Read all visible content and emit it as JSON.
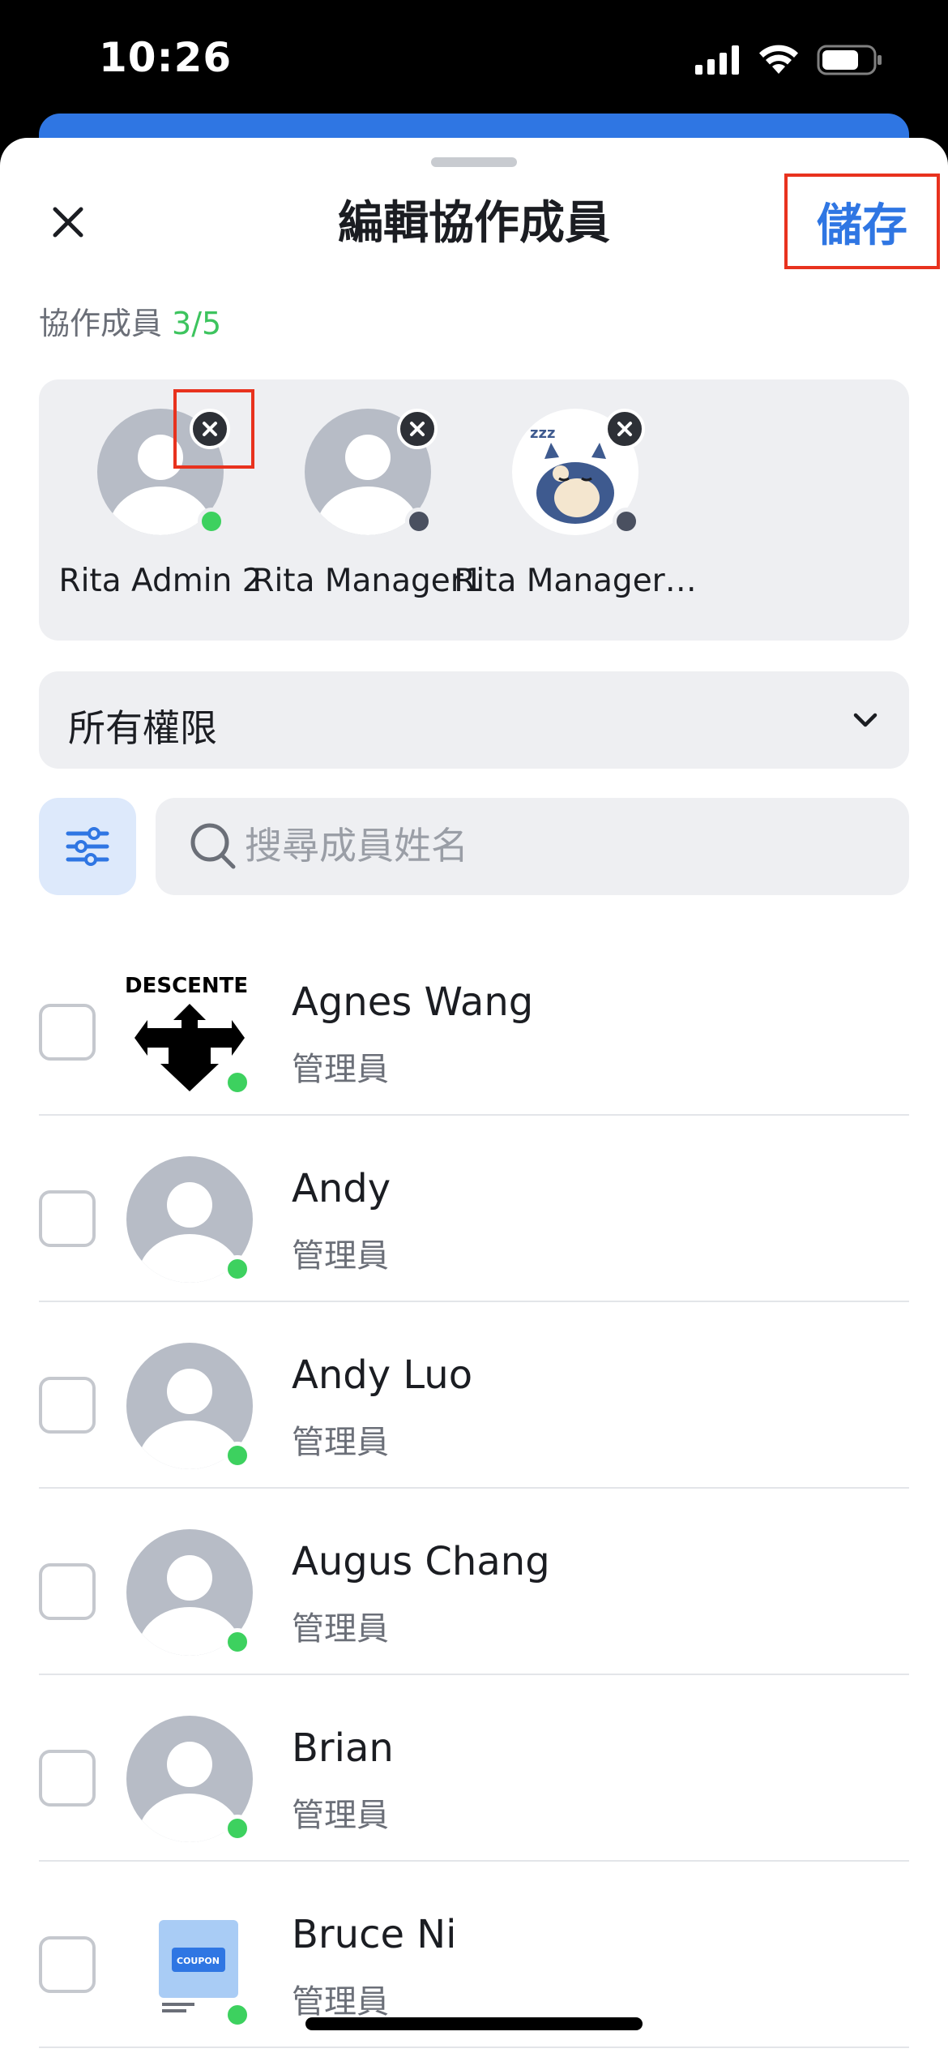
{
  "status_bar": {
    "time": "10:26"
  },
  "header": {
    "title": "編輯協作成員",
    "save_label": "儲存"
  },
  "members_header": {
    "label": "協作成員",
    "count": "3/5"
  },
  "selected_members": [
    {
      "name": "Rita Admin 2",
      "status": "online"
    },
    {
      "name": "Rita Manager1",
      "status": "offline"
    },
    {
      "name": "Rita Manager…",
      "status": "offline",
      "avatar": "sleeping-cat"
    }
  ],
  "permission_filter": {
    "value": "所有權限"
  },
  "search": {
    "placeholder": "搜尋成員姓名"
  },
  "members": [
    {
      "name": "Agnes Wang",
      "role": "管理員",
      "avatar": "descente-logo",
      "status": "online"
    },
    {
      "name": "Andy",
      "role": "管理員",
      "avatar": "default",
      "status": "online"
    },
    {
      "name": "Andy Luo",
      "role": "管理員",
      "avatar": "default",
      "status": "online"
    },
    {
      "name": "Augus Chang",
      "role": "管理員",
      "avatar": "default",
      "status": "online"
    },
    {
      "name": "Brian",
      "role": "管理員",
      "avatar": "default",
      "status": "online"
    },
    {
      "name": "Bruce Ni",
      "role": "管理員",
      "avatar": "coupon-image",
      "status": "online"
    }
  ],
  "colors": {
    "accent": "#2F76E3",
    "online": "#3DD15F",
    "offline": "#4A5060",
    "highlight": "#E8321E"
  }
}
